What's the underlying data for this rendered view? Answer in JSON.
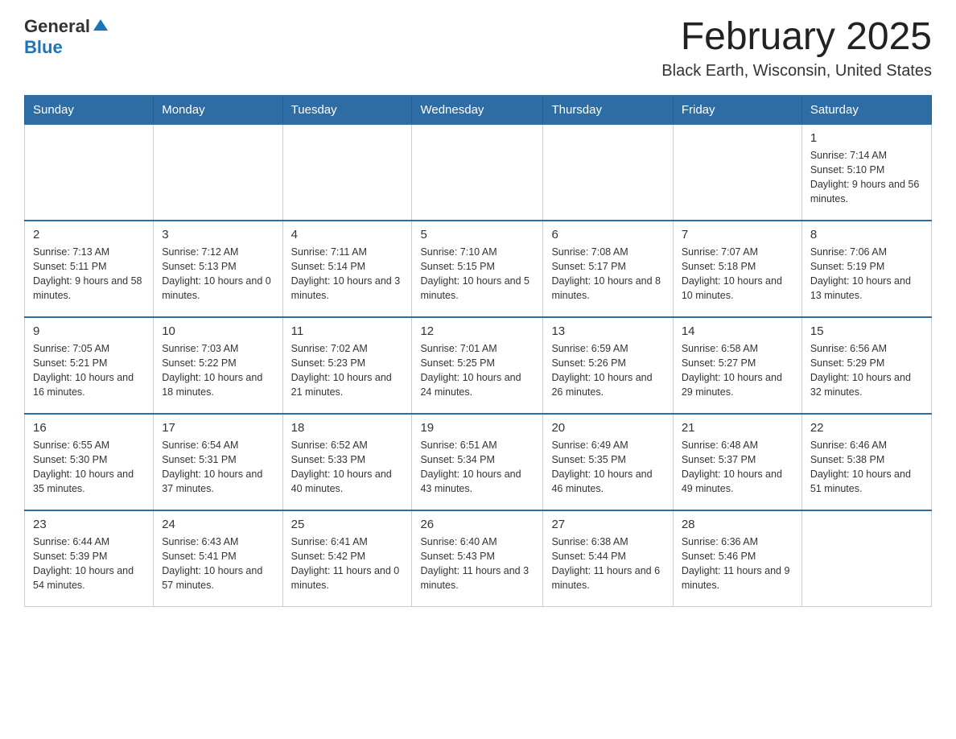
{
  "header": {
    "logo": {
      "general": "General",
      "blue": "Blue"
    },
    "title": "February 2025",
    "location": "Black Earth, Wisconsin, United States"
  },
  "weekdays": [
    "Sunday",
    "Monday",
    "Tuesday",
    "Wednesday",
    "Thursday",
    "Friday",
    "Saturday"
  ],
  "weeks": [
    [
      {
        "day": "",
        "sunrise": "",
        "sunset": "",
        "daylight": ""
      },
      {
        "day": "",
        "sunrise": "",
        "sunset": "",
        "daylight": ""
      },
      {
        "day": "",
        "sunrise": "",
        "sunset": "",
        "daylight": ""
      },
      {
        "day": "",
        "sunrise": "",
        "sunset": "",
        "daylight": ""
      },
      {
        "day": "",
        "sunrise": "",
        "sunset": "",
        "daylight": ""
      },
      {
        "day": "",
        "sunrise": "",
        "sunset": "",
        "daylight": ""
      },
      {
        "day": "1",
        "sunrise": "Sunrise: 7:14 AM",
        "sunset": "Sunset: 5:10 PM",
        "daylight": "Daylight: 9 hours and 56 minutes."
      }
    ],
    [
      {
        "day": "2",
        "sunrise": "Sunrise: 7:13 AM",
        "sunset": "Sunset: 5:11 PM",
        "daylight": "Daylight: 9 hours and 58 minutes."
      },
      {
        "day": "3",
        "sunrise": "Sunrise: 7:12 AM",
        "sunset": "Sunset: 5:13 PM",
        "daylight": "Daylight: 10 hours and 0 minutes."
      },
      {
        "day": "4",
        "sunrise": "Sunrise: 7:11 AM",
        "sunset": "Sunset: 5:14 PM",
        "daylight": "Daylight: 10 hours and 3 minutes."
      },
      {
        "day": "5",
        "sunrise": "Sunrise: 7:10 AM",
        "sunset": "Sunset: 5:15 PM",
        "daylight": "Daylight: 10 hours and 5 minutes."
      },
      {
        "day": "6",
        "sunrise": "Sunrise: 7:08 AM",
        "sunset": "Sunset: 5:17 PM",
        "daylight": "Daylight: 10 hours and 8 minutes."
      },
      {
        "day": "7",
        "sunrise": "Sunrise: 7:07 AM",
        "sunset": "Sunset: 5:18 PM",
        "daylight": "Daylight: 10 hours and 10 minutes."
      },
      {
        "day": "8",
        "sunrise": "Sunrise: 7:06 AM",
        "sunset": "Sunset: 5:19 PM",
        "daylight": "Daylight: 10 hours and 13 minutes."
      }
    ],
    [
      {
        "day": "9",
        "sunrise": "Sunrise: 7:05 AM",
        "sunset": "Sunset: 5:21 PM",
        "daylight": "Daylight: 10 hours and 16 minutes."
      },
      {
        "day": "10",
        "sunrise": "Sunrise: 7:03 AM",
        "sunset": "Sunset: 5:22 PM",
        "daylight": "Daylight: 10 hours and 18 minutes."
      },
      {
        "day": "11",
        "sunrise": "Sunrise: 7:02 AM",
        "sunset": "Sunset: 5:23 PM",
        "daylight": "Daylight: 10 hours and 21 minutes."
      },
      {
        "day": "12",
        "sunrise": "Sunrise: 7:01 AM",
        "sunset": "Sunset: 5:25 PM",
        "daylight": "Daylight: 10 hours and 24 minutes."
      },
      {
        "day": "13",
        "sunrise": "Sunrise: 6:59 AM",
        "sunset": "Sunset: 5:26 PM",
        "daylight": "Daylight: 10 hours and 26 minutes."
      },
      {
        "day": "14",
        "sunrise": "Sunrise: 6:58 AM",
        "sunset": "Sunset: 5:27 PM",
        "daylight": "Daylight: 10 hours and 29 minutes."
      },
      {
        "day": "15",
        "sunrise": "Sunrise: 6:56 AM",
        "sunset": "Sunset: 5:29 PM",
        "daylight": "Daylight: 10 hours and 32 minutes."
      }
    ],
    [
      {
        "day": "16",
        "sunrise": "Sunrise: 6:55 AM",
        "sunset": "Sunset: 5:30 PM",
        "daylight": "Daylight: 10 hours and 35 minutes."
      },
      {
        "day": "17",
        "sunrise": "Sunrise: 6:54 AM",
        "sunset": "Sunset: 5:31 PM",
        "daylight": "Daylight: 10 hours and 37 minutes."
      },
      {
        "day": "18",
        "sunrise": "Sunrise: 6:52 AM",
        "sunset": "Sunset: 5:33 PM",
        "daylight": "Daylight: 10 hours and 40 minutes."
      },
      {
        "day": "19",
        "sunrise": "Sunrise: 6:51 AM",
        "sunset": "Sunset: 5:34 PM",
        "daylight": "Daylight: 10 hours and 43 minutes."
      },
      {
        "day": "20",
        "sunrise": "Sunrise: 6:49 AM",
        "sunset": "Sunset: 5:35 PM",
        "daylight": "Daylight: 10 hours and 46 minutes."
      },
      {
        "day": "21",
        "sunrise": "Sunrise: 6:48 AM",
        "sunset": "Sunset: 5:37 PM",
        "daylight": "Daylight: 10 hours and 49 minutes."
      },
      {
        "day": "22",
        "sunrise": "Sunrise: 6:46 AM",
        "sunset": "Sunset: 5:38 PM",
        "daylight": "Daylight: 10 hours and 51 minutes."
      }
    ],
    [
      {
        "day": "23",
        "sunrise": "Sunrise: 6:44 AM",
        "sunset": "Sunset: 5:39 PM",
        "daylight": "Daylight: 10 hours and 54 minutes."
      },
      {
        "day": "24",
        "sunrise": "Sunrise: 6:43 AM",
        "sunset": "Sunset: 5:41 PM",
        "daylight": "Daylight: 10 hours and 57 minutes."
      },
      {
        "day": "25",
        "sunrise": "Sunrise: 6:41 AM",
        "sunset": "Sunset: 5:42 PM",
        "daylight": "Daylight: 11 hours and 0 minutes."
      },
      {
        "day": "26",
        "sunrise": "Sunrise: 6:40 AM",
        "sunset": "Sunset: 5:43 PM",
        "daylight": "Daylight: 11 hours and 3 minutes."
      },
      {
        "day": "27",
        "sunrise": "Sunrise: 6:38 AM",
        "sunset": "Sunset: 5:44 PM",
        "daylight": "Daylight: 11 hours and 6 minutes."
      },
      {
        "day": "28",
        "sunrise": "Sunrise: 6:36 AM",
        "sunset": "Sunset: 5:46 PM",
        "daylight": "Daylight: 11 hours and 9 minutes."
      },
      {
        "day": "",
        "sunrise": "",
        "sunset": "",
        "daylight": ""
      }
    ]
  ]
}
